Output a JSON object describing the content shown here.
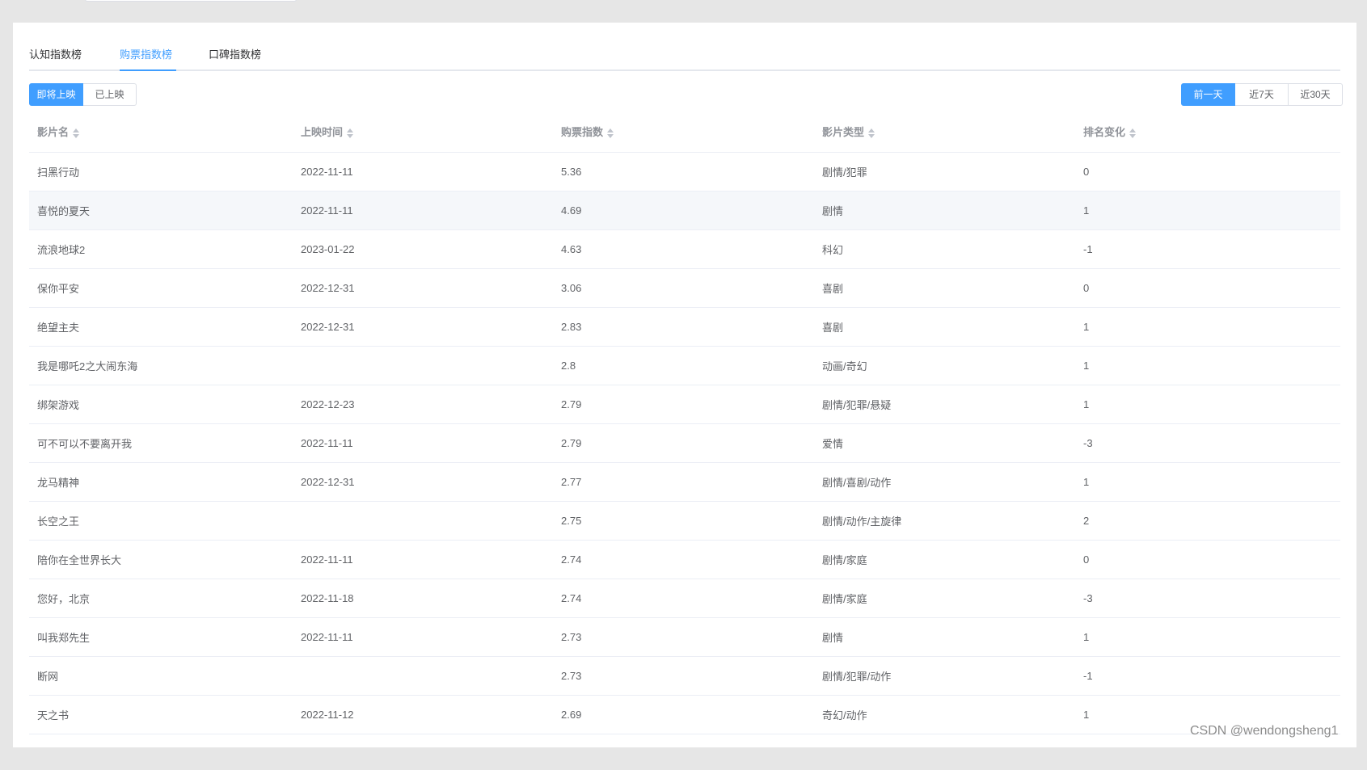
{
  "tabs": [
    {
      "label": "认知指数榜",
      "active": false
    },
    {
      "label": "购票指数榜",
      "active": true
    },
    {
      "label": "口碑指数榜",
      "active": false
    }
  ],
  "release_filter": {
    "options": [
      "即将上映",
      "已上映"
    ],
    "selected": "即将上映"
  },
  "period_filter": {
    "options": [
      "前一天",
      "近7天",
      "近30天"
    ],
    "selected": "前一天"
  },
  "table": {
    "columns": [
      "影片名",
      "上映时间",
      "购票指数",
      "影片类型",
      "排名变化"
    ],
    "rows": [
      [
        "扫黑行动",
        "2022-11-11",
        "5.36",
        "剧情/犯罪",
        "0"
      ],
      [
        "喜悦的夏天",
        "2022-11-11",
        "4.69",
        "剧情",
        "1"
      ],
      [
        "流浪地球2",
        "2023-01-22",
        "4.63",
        "科幻",
        "-1"
      ],
      [
        "保你平安",
        "2022-12-31",
        "3.06",
        "喜剧",
        "0"
      ],
      [
        "绝望主夫",
        "2022-12-31",
        "2.83",
        "喜剧",
        "1"
      ],
      [
        "我是哪吒2之大闹东海",
        "",
        "2.8",
        "动画/奇幻",
        "1"
      ],
      [
        "绑架游戏",
        "2022-12-23",
        "2.79",
        "剧情/犯罪/悬疑",
        "1"
      ],
      [
        "可不可以不要离开我",
        "2022-11-11",
        "2.79",
        "爱情",
        "-3"
      ],
      [
        "龙马精神",
        "2022-12-31",
        "2.77",
        "剧情/喜剧/动作",
        "1"
      ],
      [
        "长空之王",
        "",
        "2.75",
        "剧情/动作/主旋律",
        "2"
      ],
      [
        "陪你在全世界长大",
        "2022-11-11",
        "2.74",
        "剧情/家庭",
        "0"
      ],
      [
        "您好，北京",
        "2022-11-18",
        "2.74",
        "剧情/家庭",
        "-3"
      ],
      [
        "叫我郑先生",
        "2022-11-11",
        "2.73",
        "剧情",
        "1"
      ],
      [
        "断网",
        "",
        "2.73",
        "剧情/犯罪/动作",
        "-1"
      ],
      [
        "天之书",
        "2022-11-12",
        "2.69",
        "奇幻/动作",
        "1"
      ]
    ]
  },
  "watermark": "CSDN @wendongsheng1",
  "colors": {
    "accent": "#409eff",
    "row_hover": "#f5f7fa"
  }
}
